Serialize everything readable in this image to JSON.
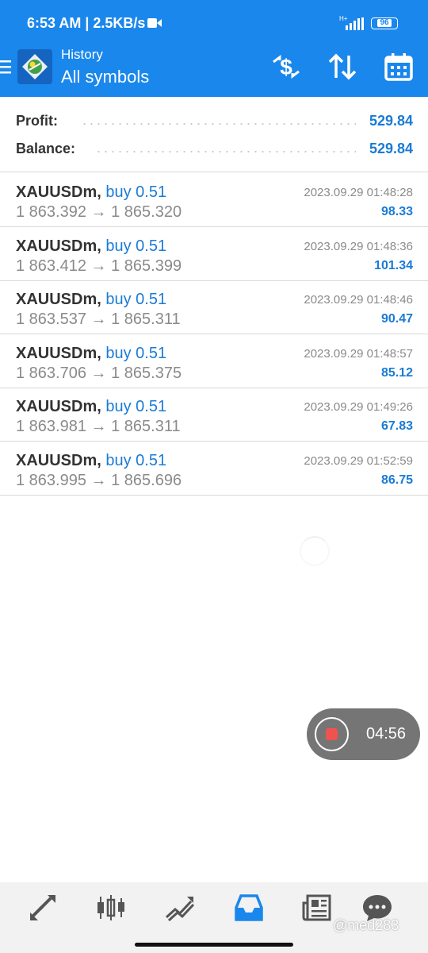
{
  "status_bar": {
    "time": "6:53 AM | 2.5KB/s",
    "network": "H+",
    "battery": "96"
  },
  "header": {
    "subtitle": "History",
    "title": "All symbols"
  },
  "summary": {
    "profit_label": "Profit:",
    "profit_value": "529.84",
    "balance_label": "Balance:",
    "balance_value": "529.84"
  },
  "deals": [
    {
      "symbol": "XAUUSDm,",
      "type": "buy 0.51",
      "open_price": "1 863.392",
      "arrow": "→",
      "close_price": "1 865.320",
      "time": "2023.09.29 01:48:28",
      "profit": "98.33"
    },
    {
      "symbol": "XAUUSDm,",
      "type": "buy 0.51",
      "open_price": "1 863.412",
      "arrow": "→",
      "close_price": "1 865.399",
      "time": "2023.09.29 01:48:36",
      "profit": "101.34"
    },
    {
      "symbol": "XAUUSDm,",
      "type": "buy 0.51",
      "open_price": "1 863.537",
      "arrow": "→",
      "close_price": "1 865.311",
      "time": "2023.09.29 01:48:46",
      "profit": "90.47"
    },
    {
      "symbol": "XAUUSDm,",
      "type": "buy 0.51",
      "open_price": "1 863.706",
      "arrow": "→",
      "close_price": "1 865.375",
      "time": "2023.09.29 01:48:57",
      "profit": "85.12"
    },
    {
      "symbol": "XAUUSDm,",
      "type": "buy 0.51",
      "open_price": "1 863.981",
      "arrow": "→",
      "close_price": "1 865.311",
      "time": "2023.09.29 01:49:26",
      "profit": "67.83"
    },
    {
      "symbol": "XAUUSDm,",
      "type": "buy 0.51",
      "open_price": "1 863.995",
      "arrow": "→",
      "close_price": "1 865.696",
      "time": "2023.09.29 01:52:59",
      "profit": "86.75"
    }
  ],
  "recorder": {
    "time": "04:56"
  },
  "watermark": "@med283",
  "icons": {
    "menu": "hamburger-icon",
    "sort": "sort-icon",
    "profit_toggle": "dollar-swap-icon",
    "calendar": "calendar-icon",
    "nav": [
      "quotes-icon",
      "chart-icon",
      "trade-icon",
      "history-icon",
      "news-icon",
      "chat-icon"
    ]
  },
  "colors": {
    "header": "#1a87ec",
    "accent": "#1a7bd6",
    "active_nav": "#1a87ec",
    "inactive_nav": "#555555",
    "recorder_stop": "#ef5350"
  }
}
